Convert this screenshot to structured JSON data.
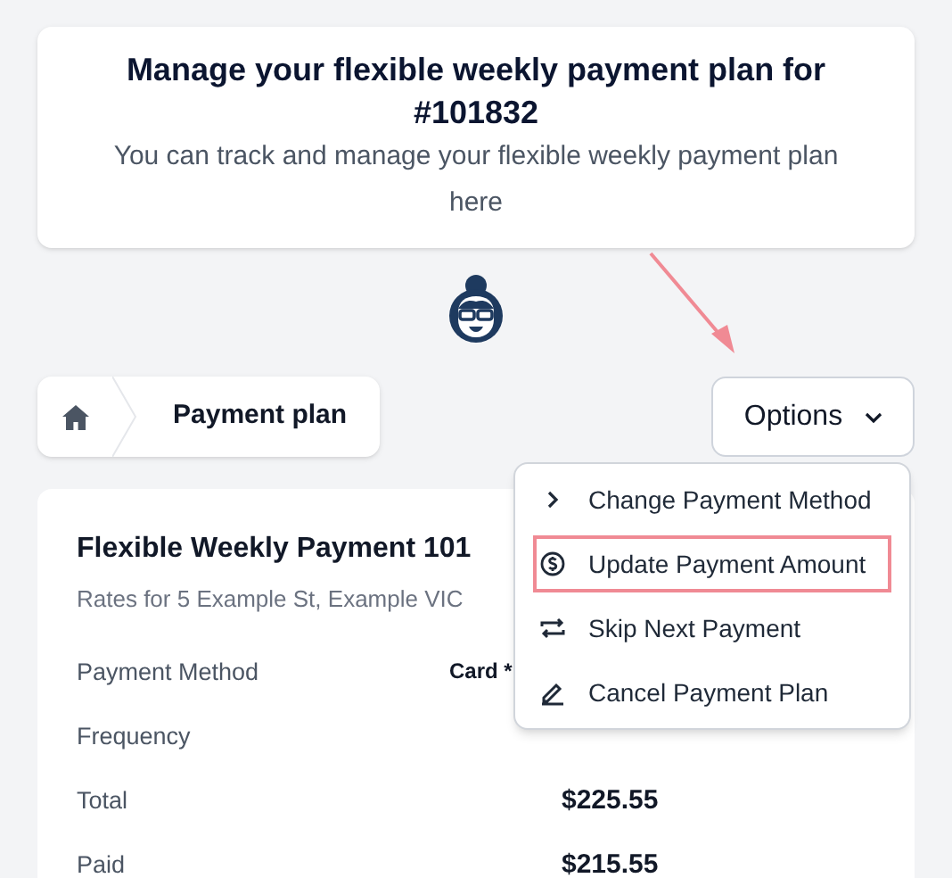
{
  "header": {
    "title": "Manage your flexible weekly payment plan for #101832",
    "subtitle": "You can track and manage your flexible weekly payment plan here"
  },
  "breadcrumb": {
    "current": "Payment plan"
  },
  "options": {
    "label": "Options",
    "expanded": true,
    "items": [
      {
        "label": "Change Payment Method",
        "highlighted": false
      },
      {
        "label": "Update Payment Amount",
        "highlighted": true
      },
      {
        "label": "Skip Next Payment",
        "highlighted": false
      },
      {
        "label": "Cancel Payment Plan",
        "highlighted": false
      }
    ]
  },
  "plan": {
    "title": "Flexible Weekly Payment 101",
    "subtitle": "Rates for 5 Example St, Example VIC",
    "rows": [
      {
        "label": "Payment Method",
        "value": "Card *",
        "kind": "method"
      },
      {
        "label": "Frequency"
      },
      {
        "label": "Total",
        "value": "$225.55",
        "kind": "amount"
      },
      {
        "label": "Paid",
        "value": "$215.55",
        "kind": "amount"
      }
    ]
  }
}
